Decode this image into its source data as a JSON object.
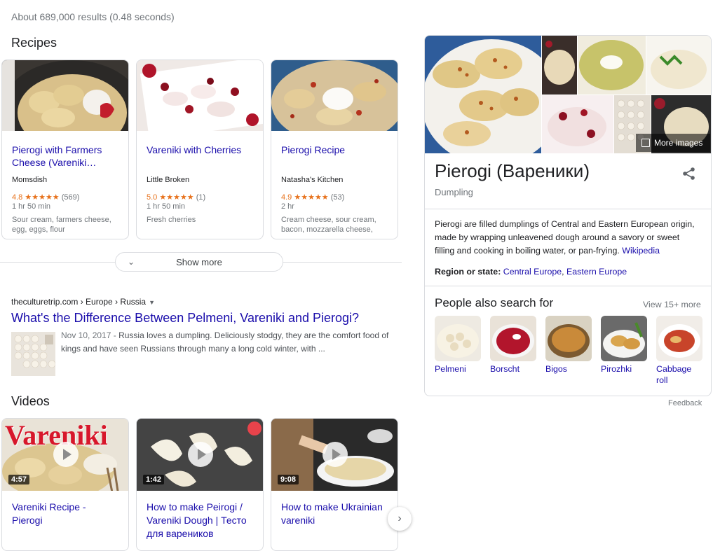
{
  "stats": "About 689,000 results (0.48 seconds)",
  "recipes": {
    "title": "Recipes",
    "cards": [
      {
        "title": "Pierogi with Farmers Cheese (Vareniki…",
        "source": "Momsdish",
        "rating": "4.8",
        "stars": "★★★★★",
        "reviews": "(569)",
        "time": "1 hr 50 min",
        "ingredients": "Sour cream, farmers cheese, egg, eggs, flour"
      },
      {
        "title": "Vareniki with Cherries",
        "source": "Little Broken",
        "rating": "5.0",
        "stars": "★★★★★",
        "reviews": "(1)",
        "time": "1 hr 50 min",
        "ingredients": "Fresh cherries"
      },
      {
        "title": "Pierogi Recipe",
        "source": "Natasha's Kitchen",
        "rating": "4.9",
        "stars": "★★★★★",
        "reviews": "(53)",
        "time": "2 hr",
        "ingredients": "Cream cheese, sour cream, bacon, mozzarella cheese,"
      }
    ],
    "show_more": "Show more"
  },
  "result": {
    "breadcrumb": "theculturetrip.com › Europe › Russia",
    "title": "What's the Difference Between Pelmeni, Vareniki and Pierogi?",
    "date": "Nov 10, 2017 -",
    "snippet": "Russia loves a dumpling. Deliciously stodgy, they are the comfort food of kings and have seen Russians through many a long cold winter, with ..."
  },
  "videos": {
    "title": "Videos",
    "items": [
      {
        "title": "Vareniki Recipe - Pierogi",
        "duration": "4:57",
        "overlay": "Vareniki"
      },
      {
        "title": "How to make Peirogi / Vareniki Dough | Тесто для вареников",
        "duration": "1:42"
      },
      {
        "title": "How to make Ukrainian vareniki",
        "duration": "9:08"
      }
    ]
  },
  "knowledge_panel": {
    "title": "Pierogi (Вареники)",
    "subtitle": "Dumpling",
    "more_images": "More images",
    "description": "Pierogi are filled dumplings of Central and Eastern European origin, made by wrapping unleavened dough around a savory or sweet filling and cooking in boiling water, or pan-frying.",
    "description_link": "Wikipedia",
    "region_label": "Region or state:",
    "region_values": [
      "Central Europe",
      "Eastern Europe"
    ],
    "people_also_search_title": "People also search for",
    "view_more": "View 15+ more",
    "people_also_search": [
      "Pelmeni",
      "Borscht",
      "Bigos",
      "Pirozhki",
      "Cabbage roll"
    ]
  },
  "feedback": "Feedback",
  "colors": {
    "link": "#1a0dab",
    "star": "#e7711b",
    "border": "#dadce0",
    "muted": "#70757a"
  }
}
